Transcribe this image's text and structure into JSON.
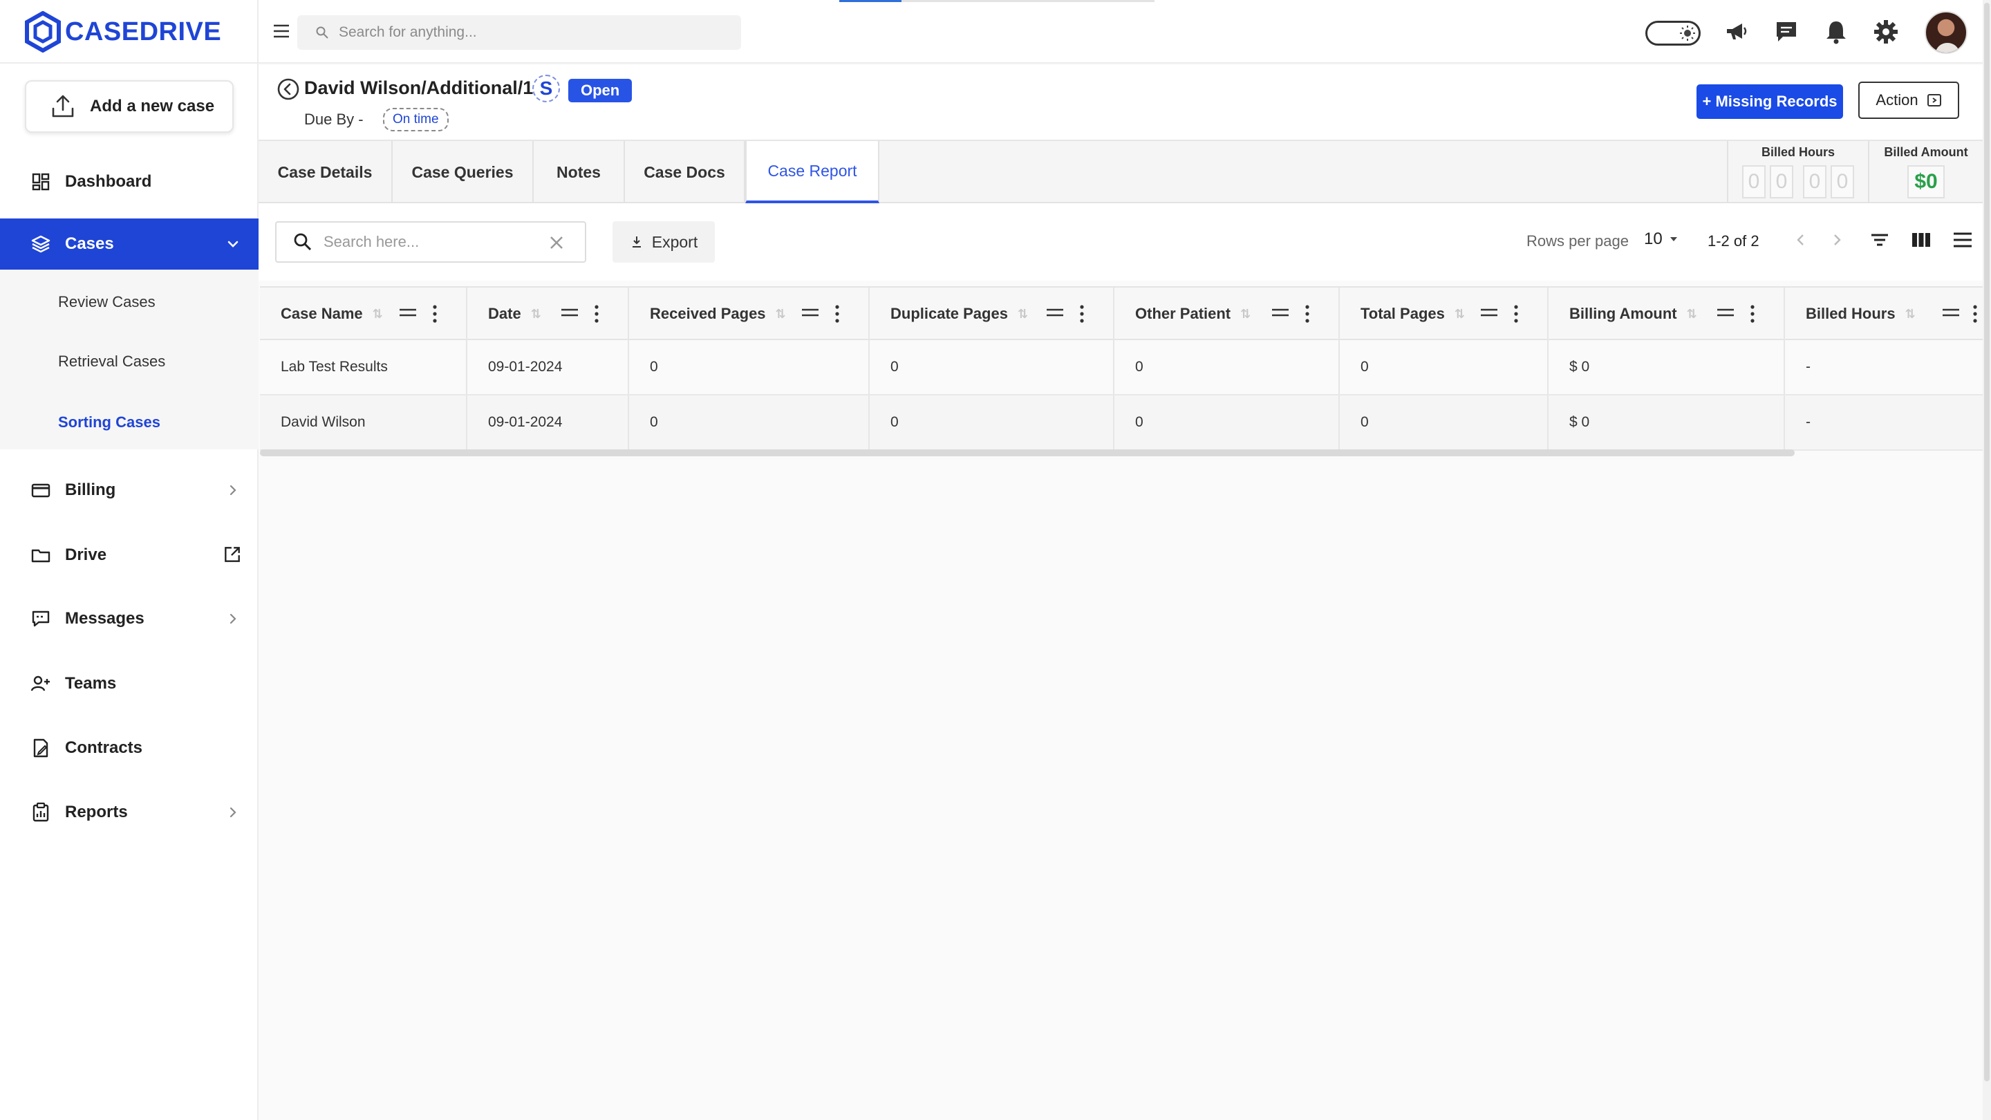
{
  "brand": {
    "name": "CASEDRIVE",
    "color": "#1f45d6"
  },
  "sidebar": {
    "add_case_label": "Add a new case",
    "items": [
      {
        "label": "Dashboard",
        "icon": "dashboard-icon"
      },
      {
        "label": "Cases",
        "icon": "layers-icon",
        "active": true
      },
      {
        "label": "Billing",
        "icon": "credit-card-icon"
      },
      {
        "label": "Drive",
        "icon": "folder-icon"
      },
      {
        "label": "Messages",
        "icon": "message-icon"
      },
      {
        "label": "Teams",
        "icon": "users-icon"
      },
      {
        "label": "Contracts",
        "icon": "contract-icon"
      },
      {
        "label": "Reports",
        "icon": "clipboard-icon"
      }
    ],
    "cases_sub": [
      "Review Cases",
      "Retrieval Cases",
      "Sorting Cases"
    ]
  },
  "topbar": {
    "search_placeholder": "Search for anything..."
  },
  "case": {
    "title": "David Wilson/Additional/1",
    "s_badge": "S",
    "status": "Open",
    "due_by": "Due By -",
    "timeliness": "On time",
    "missing_records_label": "+ Missing Records",
    "action_label": "Action"
  },
  "tabs": [
    "Case Details",
    "Case Queries",
    "Notes",
    "Case Docs",
    "Case Report"
  ],
  "active_tab": "Case Report",
  "billed": {
    "hours_label": "Billed Hours",
    "hours_digits": [
      "0",
      "0",
      "0",
      "0"
    ],
    "amount_label": "Billed Amount",
    "amount_value": "$0"
  },
  "toolbar": {
    "search_placeholder": "Search here...",
    "export_label": "Export",
    "rows_per_page_label": "Rows per page",
    "rows_per_page_value": "10",
    "page_info": "1-2 of 2"
  },
  "table": {
    "columns": [
      "Case Name",
      "Date",
      "Received Pages",
      "Duplicate Pages",
      "Other Patient",
      "Total Pages",
      "Billing Amount",
      "Billed Hours"
    ],
    "rows": [
      [
        "Lab Test Results",
        "09-01-2024",
        "0",
        "0",
        "0",
        "0",
        "$ 0",
        "-"
      ],
      [
        "David Wilson",
        "09-01-2024",
        "0",
        "0",
        "0",
        "0",
        "$ 0",
        "-"
      ]
    ]
  },
  "colors": {
    "primary": "#1f45d6",
    "button_blue": "#1a4be6",
    "amount_green": "#2aa04a"
  }
}
